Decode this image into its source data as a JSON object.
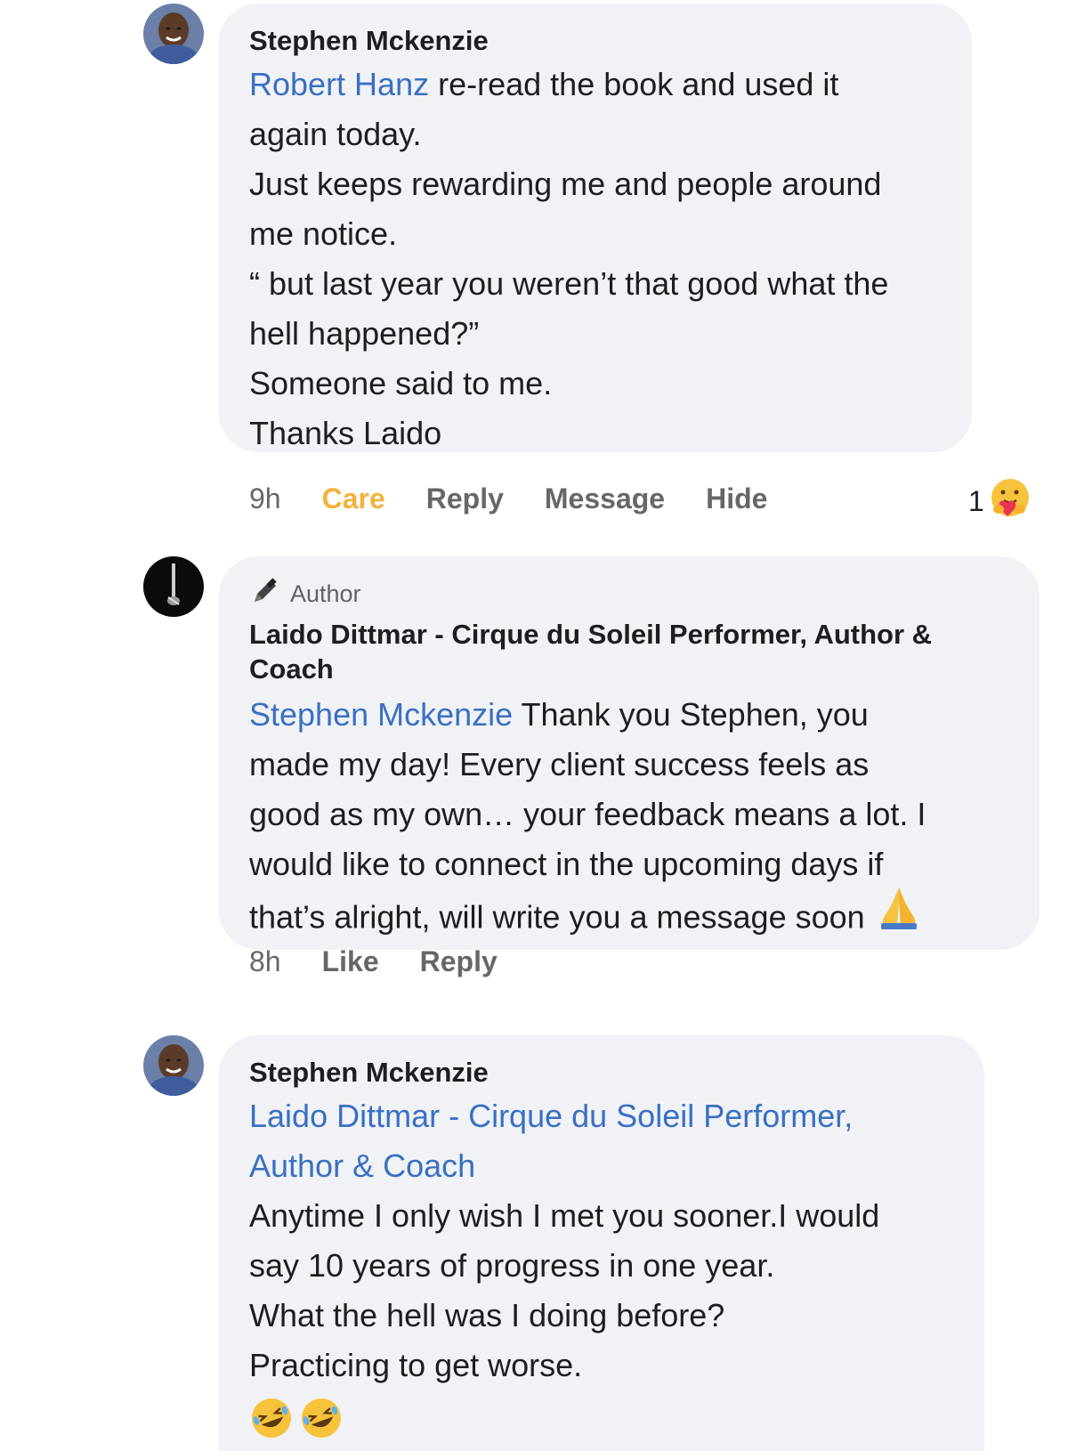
{
  "comments": [
    {
      "author": "Stephen Mckenzie",
      "mention": "Robert Hanz",
      "lines": [
        " re-read the book and used it",
        "again today.",
        "Just keeps rewarding me and people around",
        "me notice.",
        "“ but last year you weren’t that good what the",
        "hell happened?”",
        "Someone said to me.",
        "Thanks Laido"
      ],
      "actions": {
        "time": "9h",
        "care": "Care",
        "reply": "Reply",
        "message": "Message",
        "hide": "Hide"
      },
      "reaction_count": "1",
      "reaction_icon": "care-emoji-icon"
    },
    {
      "badge": "Author",
      "badge_icon": "pencil-icon",
      "author_line1": "Laido Dittmar - Cirque du Soleil Performer, Author &",
      "author_line2": "Coach",
      "mention": "Stephen Mckenzie",
      "lines": [
        " Thank you Stephen, you",
        "made my day! Every client success feels as",
        "good as my own… your feedback means a lot. I",
        "would like to connect in the upcoming days if",
        "that’s alright, will write you a message soon"
      ],
      "trailing_emoji": "folded-hands-icon",
      "actions": {
        "time": "8h",
        "like": "Like",
        "reply": "Reply"
      }
    },
    {
      "author": "Stephen Mckenzie",
      "mention_line1": "Laido Dittmar - Cirque du Soleil Performer,",
      "mention_line2": "Author & Coach",
      "lines": [
        "Anytime I only wish I met you sooner.I would",
        "say 10 years of progress in one year.",
        "What the hell was I doing before?",
        "Practicing to get worse."
      ],
      "trailing_emojis": [
        "rolling-laughing-icon",
        "rolling-laughing-icon"
      ]
    }
  ],
  "colors": {
    "bubble": "#f0f2f5",
    "mention": "#3a6fc4",
    "care": "#f2b33d",
    "muted": "#65676b"
  }
}
